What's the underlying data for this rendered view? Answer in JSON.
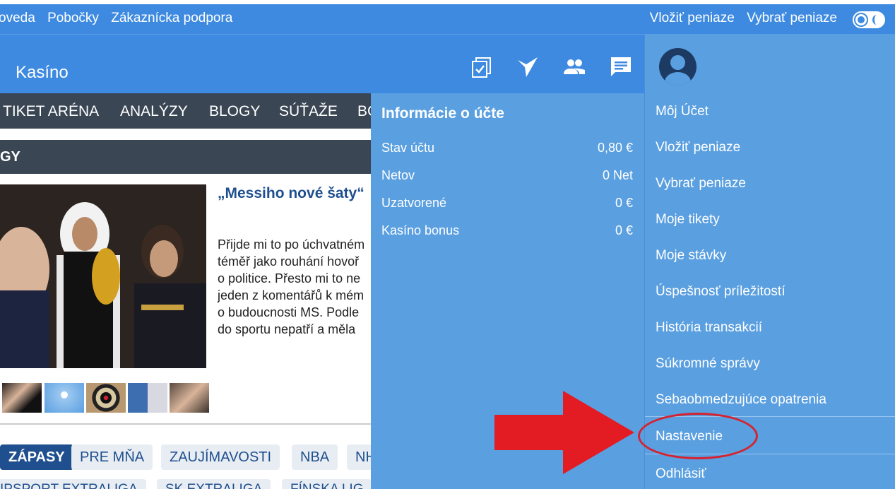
{
  "topbar": {
    "left_links": [
      "oveda",
      "Pobočky",
      "Zákaznícka podpora"
    ],
    "right_links": [
      "Vložiť peniaze",
      "Vybrať peniaze"
    ]
  },
  "header": {
    "brand": "Kasíno",
    "icons": [
      "tickets-icon",
      "checkmark-bet-icon",
      "people-icon",
      "chat-icon",
      "user-avatar-icon"
    ]
  },
  "nav": {
    "items": [
      "TIKET ARÉNA",
      "ANALÝZY",
      "BLOGY",
      "SÚŤAŽE",
      "BC"
    ]
  },
  "section": {
    "title": "GY"
  },
  "article": {
    "title": "„Messiho nové šaty“",
    "lines": [
      "Přijde mi to po úchvatném",
      "téměř jako rouhání hovoř",
      "o politice. Přesto mi to ne",
      "jeden z komentářů k mém",
      "o budoucnosti MS. Podle",
      "do sportu nepatří a měla"
    ]
  },
  "chips": [
    "ZÁPASY",
    "PRE MŇA",
    "ZAUJÍMAVOSTI",
    "NBA",
    "NH"
  ],
  "chips_row2": [
    "IPSPORT EXTRALIGA",
    "SK EXTRALIGA",
    "FÍNSKA LIG"
  ],
  "account": {
    "title": "Informácie o účte",
    "rows": [
      {
        "label": "Stav účtu",
        "value": "0,80 €"
      },
      {
        "label": "Netov",
        "value": "0 Net"
      },
      {
        "label": "Uzatvorené",
        "value": "0 €"
      },
      {
        "label": "Kasíno bonus",
        "value": "0 €"
      }
    ]
  },
  "menu": {
    "items": [
      "Môj Účet",
      "Vložiť peniaze",
      "Vybrať peniaze",
      "Moje tikety",
      "Moje stávky",
      "Úspešnosť príležitostí",
      "História transakcií",
      "Súkromné správy",
      "Sebaobmedzujúce opatrenia",
      "Nastavenie",
      "Odhlásiť"
    ]
  },
  "colors": {
    "primary": "#3d8ae0",
    "panel": "#5a9fe0",
    "nav_dark": "#3a4654",
    "annotation_red": "#e31b23"
  }
}
